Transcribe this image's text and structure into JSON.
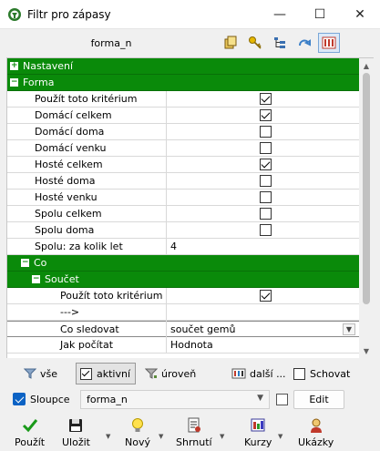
{
  "window": {
    "title": "Filtr pro zápasy",
    "minimize": "—",
    "maximize": "☐",
    "close": "✕"
  },
  "header": {
    "name": "forma_n"
  },
  "grid": {
    "rows": [
      {
        "type": "group",
        "toggle": "+",
        "label": "Nastavení",
        "indent": 0
      },
      {
        "type": "group",
        "toggle": "−",
        "label": "Forma",
        "indent": 0
      },
      {
        "type": "prop",
        "label": "Použít toto kritérium",
        "checked": true
      },
      {
        "type": "prop",
        "label": "Domácí celkem",
        "checked": true
      },
      {
        "type": "prop",
        "label": "Domácí doma",
        "checked": false
      },
      {
        "type": "prop",
        "label": "Domácí venku",
        "checked": false
      },
      {
        "type": "prop",
        "label": "Hosté celkem",
        "checked": true
      },
      {
        "type": "prop",
        "label": "Hosté doma",
        "checked": false
      },
      {
        "type": "prop",
        "label": "Hosté venku",
        "checked": false
      },
      {
        "type": "prop",
        "label": "Spolu celkem",
        "checked": false
      },
      {
        "type": "prop",
        "label": "Spolu doma",
        "checked": false
      },
      {
        "type": "prop",
        "label": "Spolu: za kolik let",
        "value": "4"
      },
      {
        "type": "group",
        "toggle": "−",
        "label": "Co",
        "indent": 1
      },
      {
        "type": "group",
        "toggle": "−",
        "label": "Součet",
        "indent": 2
      },
      {
        "type": "prop2",
        "label": "Použít toto kritérium",
        "checked": true
      },
      {
        "type": "prop2",
        "label": "--->",
        "value": ""
      },
      {
        "type": "prop2",
        "label": "Co sledovat",
        "value": "součet gemů",
        "dropdown": true,
        "selected": true
      },
      {
        "type": "prop2",
        "label": "Jak počítat",
        "value": "Hodnota"
      }
    ]
  },
  "filterbar": {
    "all": "vše",
    "active": "aktivní",
    "level": "úroveň",
    "more": "další ...",
    "hide": "Schovat"
  },
  "columns": {
    "label": "Sloupce",
    "combo_value": "forma_n",
    "edit": "Edit"
  },
  "bottom": {
    "apply": "Použít",
    "save": "Uložit",
    "new": "Nový",
    "summary": "Shrnutí",
    "rates": "Kurzy",
    "examples": "Ukázky"
  },
  "colors": {
    "group_green": "#0a8a0a",
    "accent_blue": "#0b62c4"
  }
}
